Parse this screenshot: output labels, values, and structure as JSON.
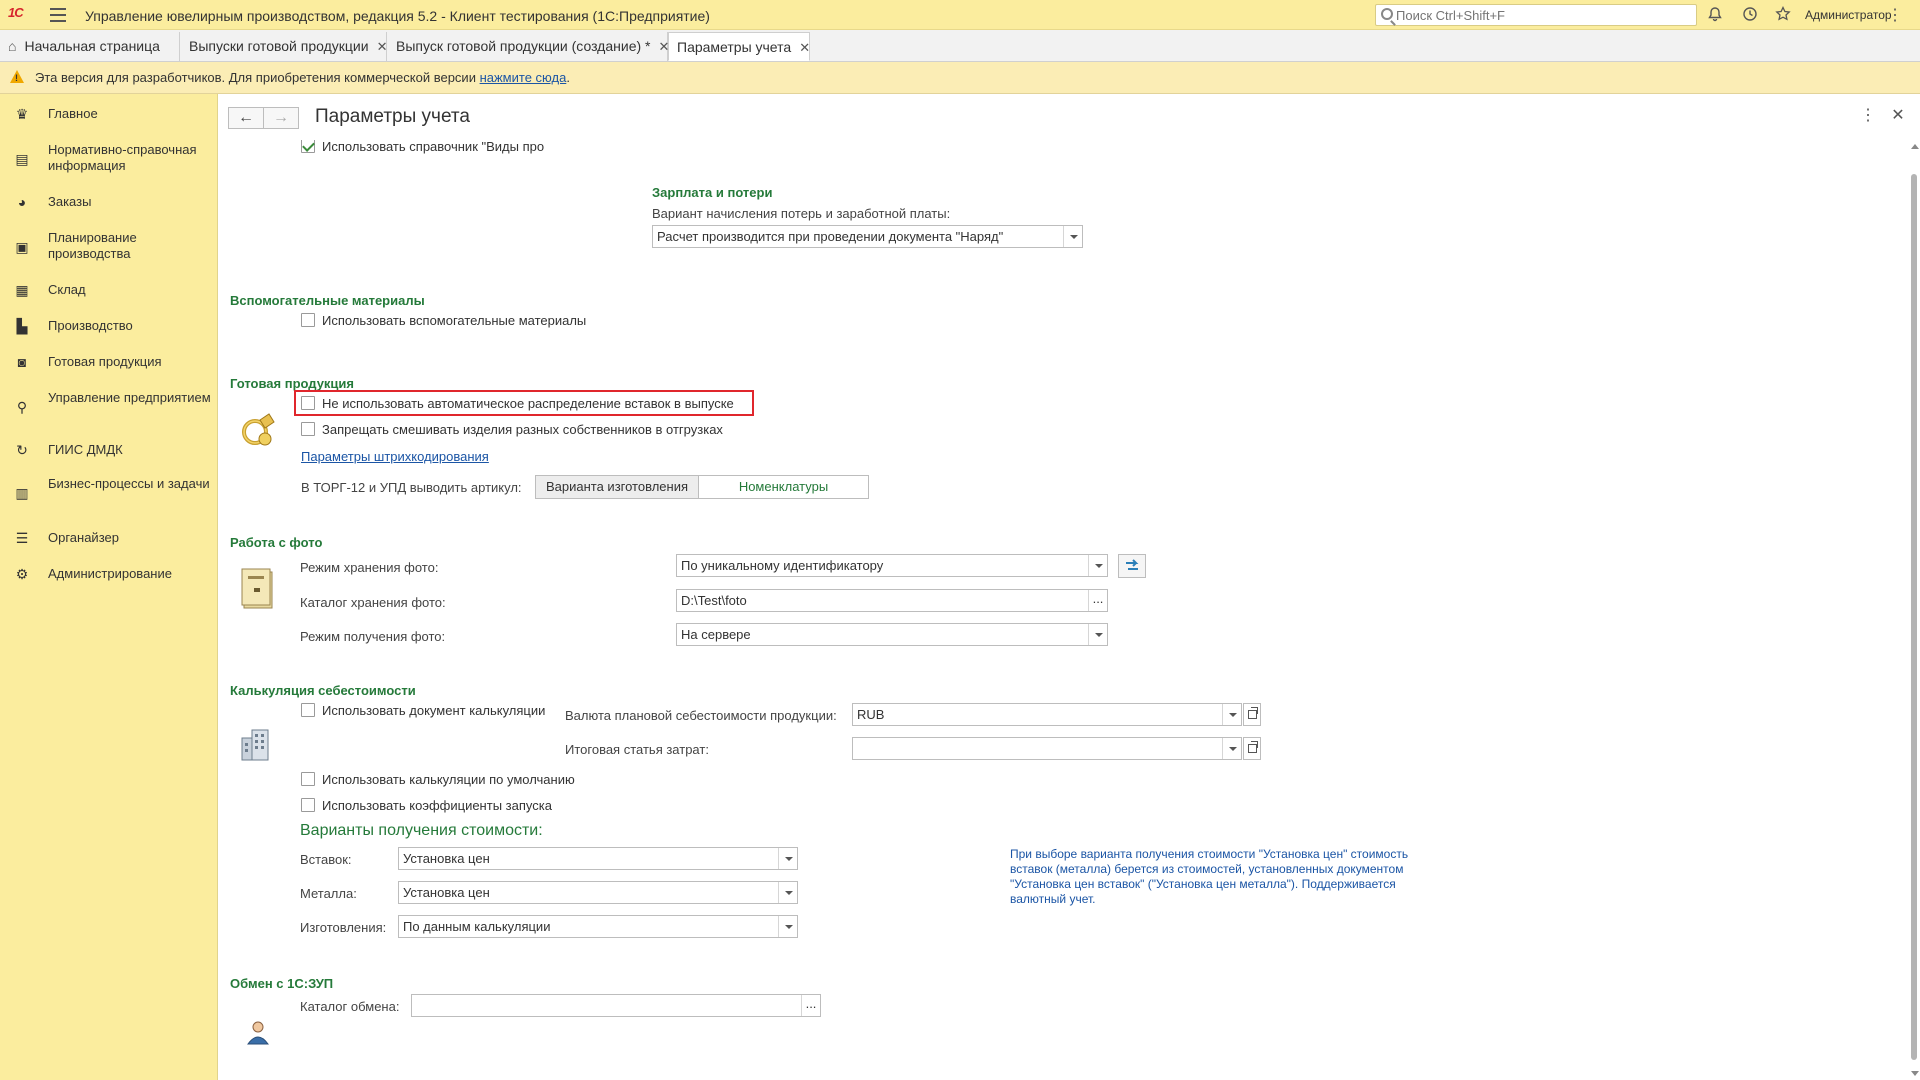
{
  "app": {
    "logo": "1С",
    "title": "Управление ювелирным производством, редакция 5.2  - Клиент тестирования (1С:Предприятие)",
    "search_placeholder": "Поиск Ctrl+Shift+F",
    "user": "Администратор"
  },
  "tabs": [
    {
      "label": "Начальная страница"
    },
    {
      "label": "Выпуски готовой продукции"
    },
    {
      "label": "Выпуск готовой продукции (создание) *"
    },
    {
      "label": "Параметры учета"
    }
  ],
  "warning": {
    "text": "Эта версия для разработчиков. Для приобретения коммерческой версии ",
    "link": "нажмите сюда",
    "tail": "."
  },
  "sidebar": {
    "items": [
      {
        "label": "Главное",
        "icon": "crown-icon"
      },
      {
        "label": "Нормативно-справочная информация",
        "icon": "book-icon"
      },
      {
        "label": "Заказы",
        "icon": "pie-icon"
      },
      {
        "label": "Планирование производства",
        "icon": "clipboard-icon"
      },
      {
        "label": "Склад",
        "icon": "grid-icon"
      },
      {
        "label": "Производство",
        "icon": "factory-icon"
      },
      {
        "label": "Готовая продукция",
        "icon": "bag-icon"
      },
      {
        "label": "Управление предприятием",
        "icon": "org-icon"
      },
      {
        "label": "ГИИС ДМДК",
        "icon": "refresh-icon"
      },
      {
        "label": "Бизнес-процессы и задачи",
        "icon": "building-icon"
      },
      {
        "label": "Органайзер",
        "icon": "list-icon"
      },
      {
        "label": "Администрирование",
        "icon": "gear-icon"
      }
    ]
  },
  "form": {
    "title": "Параметры учета",
    "top_checkbox": "Использовать справочник \"Виды про",
    "salary": {
      "title": "Зарплата и потери",
      "label": "Вариант начисления потерь и заработной платы:",
      "value": "Расчет производится при проведении документа \"Наряд\""
    },
    "aux": {
      "title": "Вспомогательные материалы",
      "checkbox": "Использовать вспомогательные материалы"
    },
    "finished": {
      "title": "Готовая продукция",
      "checkbox1": "Не использовать автоматическое распределение вставок в выпуске",
      "checkbox2": "Запрещать смешивать изделия разных собственников в отгрузках",
      "link": "Параметры штрихкодирования",
      "article_label": "В ТОРГ-12 и УПД выводить артикул:",
      "seg_left": "Варианта изготовления",
      "seg_right": "Номенклатуры"
    },
    "photo": {
      "title": "Работа с фото",
      "storage_label": "Режим хранения фото:",
      "storage_value": "По уникальному идентификатору",
      "catalog_label": "Каталог хранения фото:",
      "catalog_value": "D:\\Test\\foto",
      "receive_label": "Режим получения фото:",
      "receive_value": "На сервере"
    },
    "costing": {
      "title": "Калькуляция себестоимости",
      "cb_doc": "Использовать документ калькуляции",
      "currency_label": "Валюта плановой себестоимости продукции:",
      "currency_value": "RUB",
      "article_label": "Итоговая статья затрат:",
      "article_value": "",
      "cb_default": "Использовать калькуляции по умолчанию",
      "cb_coef": "Использовать коэффициенты запуска",
      "variants_title": "Варианты получения стоимости:",
      "inserts_label": "Вставок:",
      "inserts_value": "Установка цен",
      "metal_label": "Металла:",
      "metal_value": "Установка цен",
      "make_label": "Изготовления:",
      "make_value": "По данным калькуляции",
      "hint": "При выборе варианта получения стоимости \"Установка цен\" стоимость вставок (металла) берется из стоимостей, установленных документом \"Установка цен вставок\" (\"Установка цен металла\"). Поддерживается валютный учет."
    },
    "exchange": {
      "title": "Обмен с 1С:ЗУП",
      "catalog_label": "Каталог обмена:",
      "catalog_value": ""
    }
  }
}
